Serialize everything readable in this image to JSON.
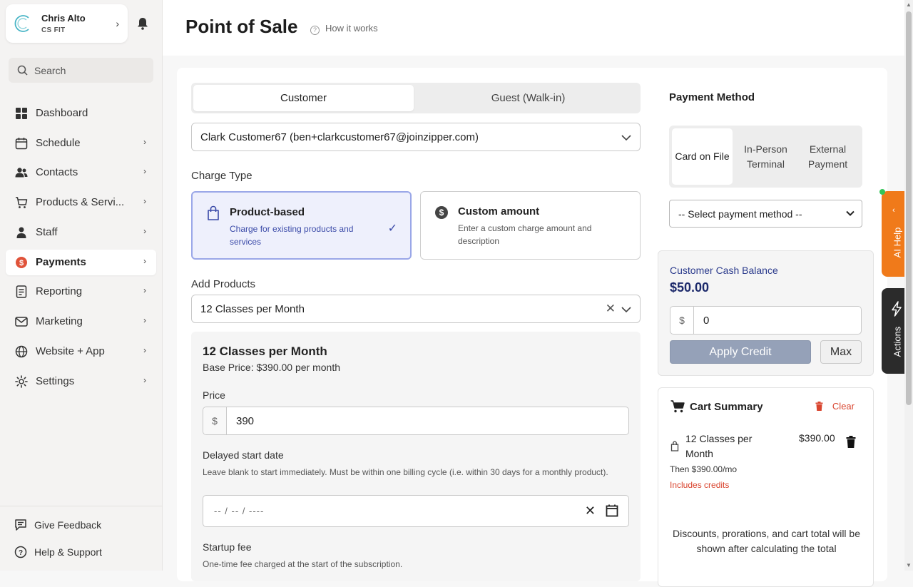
{
  "account": {
    "name": "Chris Alto",
    "org": "CS FIT"
  },
  "search": {
    "placeholder": "Search"
  },
  "nav": [
    {
      "label": "Dashboard",
      "icon": "grid-icon"
    },
    {
      "label": "Schedule",
      "icon": "calendar-icon"
    },
    {
      "label": "Contacts",
      "icon": "users-icon"
    },
    {
      "label": "Products & Servi...",
      "icon": "cart-icon"
    },
    {
      "label": "Staff",
      "icon": "person-icon"
    },
    {
      "label": "Payments",
      "icon": "dollar-icon"
    },
    {
      "label": "Reporting",
      "icon": "report-icon"
    },
    {
      "label": "Marketing",
      "icon": "mail-icon"
    },
    {
      "label": "Website + App",
      "icon": "globe-icon"
    },
    {
      "label": "Settings",
      "icon": "gear-icon"
    }
  ],
  "bottom": {
    "feedback": "Give Feedback",
    "help": "Help & Support"
  },
  "header": {
    "title": "Point of Sale",
    "how": "How it works"
  },
  "customer_tabs": {
    "customer": "Customer",
    "guest": "Guest (Walk-in)"
  },
  "customer_select": {
    "value": "Clark Customer67 (ben+clarkcustomer67@joinzipper.com)"
  },
  "charge_type": {
    "label": "Charge Type",
    "product": {
      "title": "Product-based",
      "desc": "Charge for existing products and services"
    },
    "custom": {
      "title": "Custom amount",
      "desc": "Enter a custom charge amount and description"
    }
  },
  "add_products": {
    "label": "Add Products",
    "value": "12 Classes per Month"
  },
  "product_panel": {
    "title": "12 Classes per Month",
    "base_price": "Base Price: $390.00 per month",
    "price_label": "Price",
    "currency": "$",
    "price_value": "390",
    "delayed_label": "Delayed start date",
    "delayed_help": "Leave blank to start immediately. Must be within one billing cycle (i.e. within 30 days for a monthly product).",
    "date_value": "-- / -- /  ----",
    "startup_label": "Startup fee",
    "startup_help": "One-time fee charged at the start of the subscription."
  },
  "payment": {
    "title": "Payment Method",
    "tabs": [
      "Card on File",
      "In-Person Terminal",
      "External Payment"
    ],
    "select": "-- Select payment method --"
  },
  "cash": {
    "title": "Customer Cash Balance",
    "balance": "$50.00",
    "currency": "$",
    "value": "0",
    "apply": "Apply Credit",
    "max": "Max"
  },
  "cart": {
    "title": "Cart Summary",
    "clear": "Clear",
    "item_name": "12 Classes per Month",
    "item_price": "$390.00",
    "then": "Then $390.00/mo",
    "credits": "Includes credits",
    "note": "Discounts, prorations, and cart total will be shown after calculating the total"
  },
  "side_tabs": {
    "ai": "AI Help",
    "actions": "Actions"
  },
  "colors": {
    "accent": "#3a4aa8",
    "orange": "#f07a1a",
    "danger": "#d9452f",
    "payments_icon": "#e0533a"
  }
}
